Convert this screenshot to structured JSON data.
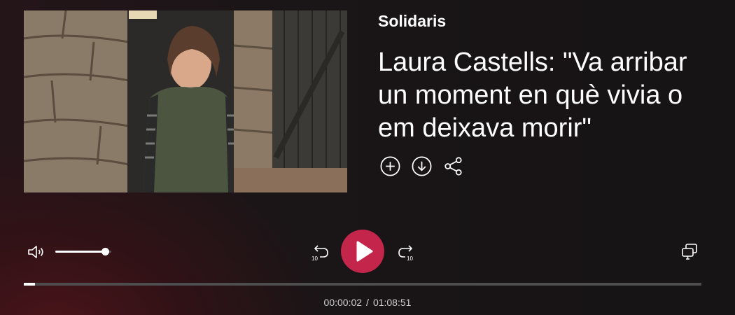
{
  "episode": {
    "program": "Solidaris",
    "title": "Laura Castells: \"Va arribar un moment en què vivia o em deixava morir\""
  },
  "actions": {
    "add_icon": "plus-circle-icon",
    "download_icon": "download-circle-icon",
    "share_icon": "share-icon"
  },
  "player": {
    "volume_fraction": 0.9,
    "progress_fraction": 0.0005,
    "rewind_label": "10",
    "forward_label": "10",
    "current_time": "00:00:02",
    "separator": "/",
    "total_time": "01:08:51",
    "accent_color": "#c4254a"
  }
}
